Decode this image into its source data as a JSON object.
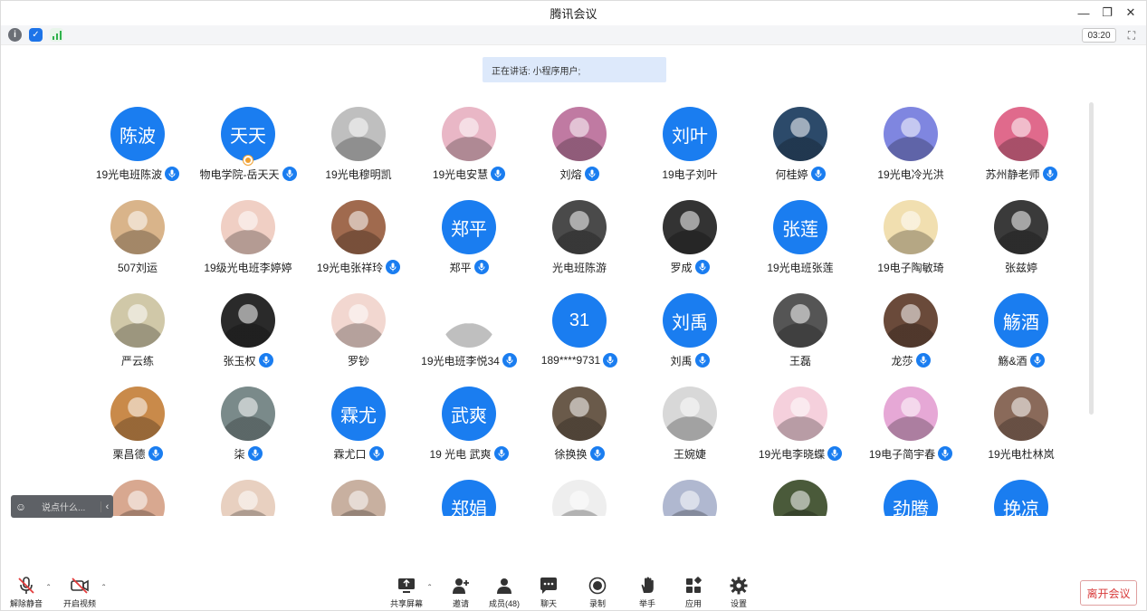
{
  "window": {
    "title": "腾讯会议"
  },
  "timer": "03:20",
  "speaking": "正在讲话: 小程序用户;",
  "chat": {
    "placeholder": "说点什么..."
  },
  "participants": [
    {
      "name": "19光电班陈波",
      "avatar": "陈波",
      "mic": true,
      "color": "#1a7df0"
    },
    {
      "name": "物电学院-岳天天",
      "avatar": "天天",
      "mic": true,
      "host": true,
      "color": "#1a7df0"
    },
    {
      "name": "19光电穆明凯",
      "avatar": "",
      "mic": false,
      "color": "#bfbfbf"
    },
    {
      "name": "19光电安慧",
      "avatar": "",
      "mic": true,
      "color": "#e9b7c6"
    },
    {
      "name": "刘熔",
      "avatar": "",
      "mic": true,
      "color": "#c07aa2"
    },
    {
      "name": "19电子刘叶",
      "avatar": "刘叶",
      "mic": false,
      "color": "#1a7df0"
    },
    {
      "name": "何桂婷",
      "avatar": "",
      "mic": true,
      "color": "#2c4a6a"
    },
    {
      "name": "19光电冷光洪",
      "avatar": "",
      "mic": false,
      "color": "#7f86e0"
    },
    {
      "name": "苏州静老师",
      "avatar": "",
      "mic": true,
      "color": "#e06a8c"
    },
    {
      "name": "507刘运",
      "avatar": "",
      "mic": false,
      "color": "#d9b48a"
    },
    {
      "name": "19级光电班李婷婷",
      "avatar": "",
      "mic": false,
      "color": "#f0cfc4"
    },
    {
      "name": "19光电张祥玲",
      "avatar": "",
      "mic": true,
      "color": "#a06a4e"
    },
    {
      "name": "郑平",
      "avatar": "郑平",
      "mic": true,
      "color": "#1a7df0"
    },
    {
      "name": "光电班陈游",
      "avatar": "",
      "mic": false,
      "color": "#4a4a4a"
    },
    {
      "name": "罗成",
      "avatar": "",
      "mic": true,
      "color": "#333333"
    },
    {
      "name": "19光电班张莲",
      "avatar": "张莲",
      "mic": false,
      "color": "#1a7df0"
    },
    {
      "name": "19电子陶敏琦",
      "avatar": "",
      "mic": false,
      "color": "#f1dfb0"
    },
    {
      "name": "张兹婷",
      "avatar": "",
      "mic": false,
      "color": "#3a3a3a"
    },
    {
      "name": "严云练",
      "avatar": "",
      "mic": false,
      "color": "#d0c8a8"
    },
    {
      "name": "张玉权",
      "avatar": "",
      "mic": true,
      "color": "#2a2a2a"
    },
    {
      "name": "罗钞",
      "avatar": "",
      "mic": false,
      "color": "#f2d7d0"
    },
    {
      "name": "19光电班李悦34",
      "avatar": "",
      "mic": true,
      "color": "#ffffff"
    },
    {
      "name": "189****9731",
      "avatar": "31",
      "mic": true,
      "color": "#1a7df0"
    },
    {
      "name": "刘禹",
      "avatar": "刘禹",
      "mic": true,
      "color": "#1a7df0"
    },
    {
      "name": "王磊",
      "avatar": "",
      "mic": false,
      "color": "#555555"
    },
    {
      "name": "龙莎",
      "avatar": "",
      "mic": true,
      "color": "#6a4a3a"
    },
    {
      "name": "觞&酒",
      "avatar": "觞酒",
      "mic": true,
      "color": "#1a7df0"
    },
    {
      "name": "栗昌德",
      "avatar": "",
      "mic": true,
      "color": "#c98a4a"
    },
    {
      "name": "柒",
      "avatar": "",
      "mic": true,
      "color": "#7a8a8a"
    },
    {
      "name": "霖尤口",
      "avatar": "霖尤",
      "mic": true,
      "color": "#1a7df0"
    },
    {
      "name": "19 光电 武爽",
      "avatar": "武爽",
      "mic": true,
      "color": "#1a7df0"
    },
    {
      "name": "徐换换",
      "avatar": "",
      "mic": true,
      "color": "#6a5a4a"
    },
    {
      "name": "王婉婕",
      "avatar": "",
      "mic": false,
      "color": "#d8d8d8"
    },
    {
      "name": "19光电李晓蝶",
      "avatar": "",
      "mic": true,
      "color": "#f5d0dc"
    },
    {
      "name": "19电子简宇春",
      "avatar": "",
      "mic": true,
      "color": "#e6a8d6"
    },
    {
      "name": "19光电杜林岚",
      "avatar": "",
      "mic": false,
      "color": "#8a6a5a"
    },
    {
      "name": "",
      "avatar": "",
      "mic": false,
      "color": "#d8a890"
    },
    {
      "name": "",
      "avatar": "",
      "mic": false,
      "color": "#e8d0c0"
    },
    {
      "name": "",
      "avatar": "",
      "mic": false,
      "color": "#c8b0a0"
    },
    {
      "name": "",
      "avatar": "郑娟",
      "mic": false,
      "color": "#1a7df0"
    },
    {
      "name": "",
      "avatar": "",
      "mic": false,
      "color": "#eeeeee"
    },
    {
      "name": "",
      "avatar": "",
      "mic": false,
      "color": "#b0b8d0"
    },
    {
      "name": "",
      "avatar": "",
      "mic": false,
      "color": "#4a5a3a"
    },
    {
      "name": "",
      "avatar": "劲腾",
      "mic": false,
      "color": "#1a7df0"
    },
    {
      "name": "",
      "avatar": "挽凉",
      "mic": false,
      "color": "#1a7df0"
    }
  ],
  "toolbar": {
    "unmute": "解除静音",
    "start_video": "开启视频",
    "share_screen": "共享屏幕",
    "invite": "邀请",
    "members": "成员(48)",
    "chat": "聊天",
    "record": "录制",
    "raise_hand": "举手",
    "apps": "应用",
    "settings": "设置",
    "leave": "离开会议"
  }
}
